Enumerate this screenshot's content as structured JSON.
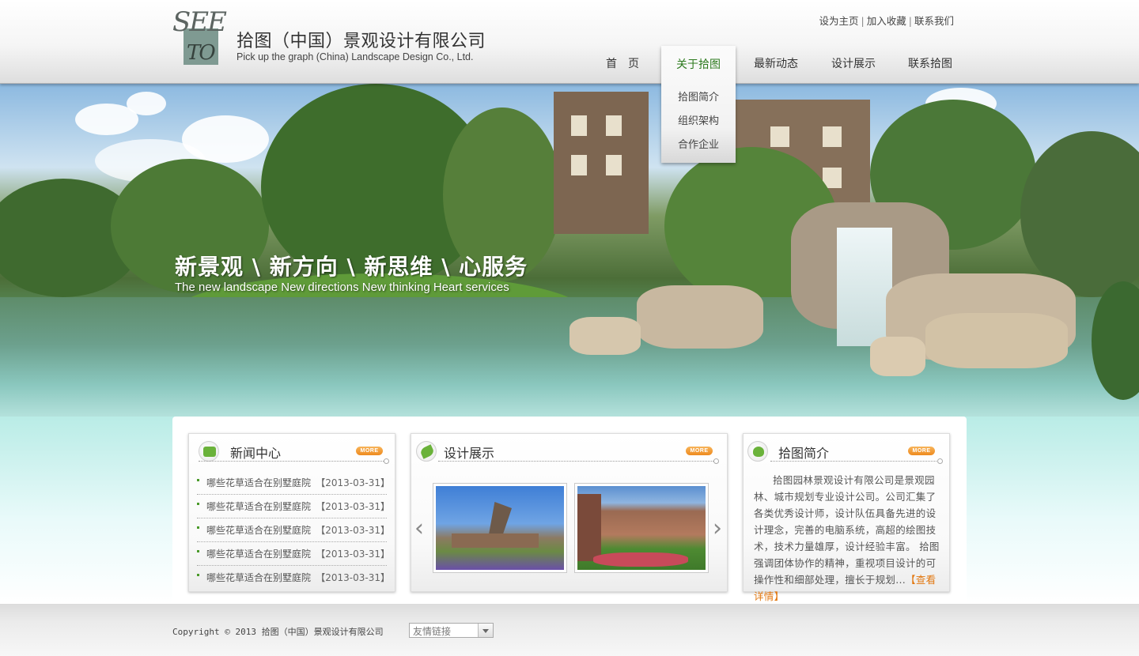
{
  "header": {
    "company_cn": "拾图（中国）景观设计有限公司",
    "company_en": "Pick up the graph (China) Landscape Design Co., Ltd.",
    "logo_see": "SEE",
    "logo_to": "TO",
    "top_links": [
      "设为主页",
      "加入收藏",
      "联系我们"
    ],
    "top_link_separator": "|"
  },
  "nav": {
    "items": [
      "首　页",
      "关于拾图",
      "最新动态",
      "设计展示",
      "联系拾图"
    ],
    "active_index": 1,
    "dropdown": [
      "拾图简介",
      "组织架构",
      "合作企业"
    ],
    "active_color": "#2d7a1e"
  },
  "banner": {
    "slogan_cn": "新景观 \\ 新方向 \\ 新思维 \\ 心服务",
    "slogan_en": "The new landscape  New directions  New thinking  Heart services"
  },
  "news": {
    "title": "新闻中心",
    "more": "MORE",
    "items": [
      {
        "title": "哪些花草适合在别墅庭院",
        "date": "【2013-03-31】"
      },
      {
        "title": "哪些花草适合在别墅庭院",
        "date": "【2013-03-31】"
      },
      {
        "title": "哪些花草适合在别墅庭院",
        "date": "【2013-03-31】"
      },
      {
        "title": "哪些花草适合在别墅庭院",
        "date": "【2013-03-31】"
      },
      {
        "title": "哪些花草适合在别墅庭院",
        "date": "【2013-03-31】"
      }
    ]
  },
  "design": {
    "title": "设计展示",
    "more": "MORE",
    "prev": "‹",
    "next": "›"
  },
  "intro": {
    "title": "拾图简介",
    "more": "MORE",
    "text": "拾图园林景观设计有限公司是景观园林、城市规划专业设计公司。公司汇集了各类优秀设计师，设计队伍具备先进的设计理念，完善的电脑系统，高超的绘图技术，技术力量雄厚，设计经验丰富。 拾图强调团体协作的精神，重视项目设计的可操作性和细部处理，擅长于规划...",
    "read_more": "【查看详情】"
  },
  "footer": {
    "copyright": "Copyright © 2013 拾图（中国）景观设计有限公司",
    "friend_links_selected": "友情链接"
  },
  "colors": {
    "accent_green": "#4a9a2a",
    "more_orange": "#ee8a1e",
    "read_more": "#e2770f"
  }
}
